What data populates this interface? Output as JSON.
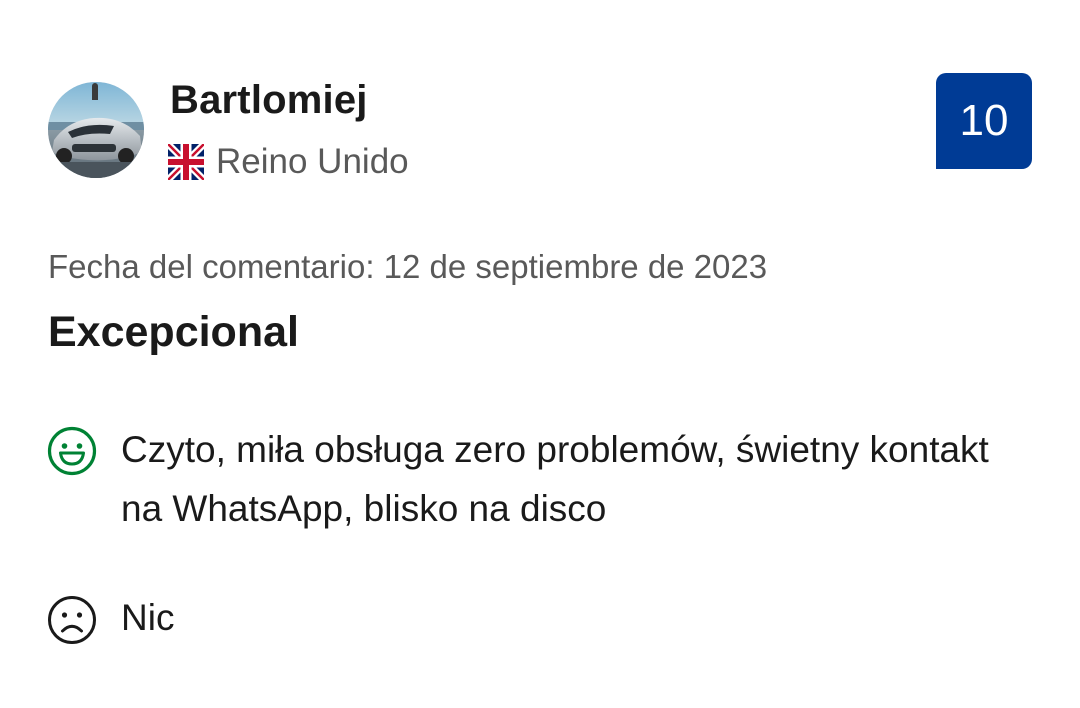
{
  "reviewer": {
    "name": "Bartlomiej",
    "country": "Reino Unido",
    "avatar_icon": "avatar-photo",
    "flag_icon": "uk-flag-icon"
  },
  "score": {
    "value": "10",
    "color": "#003b95"
  },
  "review": {
    "date": "Fecha del comentario: 12 de septiembre de 2023",
    "title": "Excepcional",
    "positive": {
      "icon": "smiley-face-icon",
      "color": "#008234",
      "text": "Czyto, miła obsługa zero problemów, świetny kontakt na WhatsApp, blisko na disco"
    },
    "negative": {
      "icon": "sad-face-icon",
      "color": "#1a1a1a",
      "text": "Nic"
    }
  }
}
